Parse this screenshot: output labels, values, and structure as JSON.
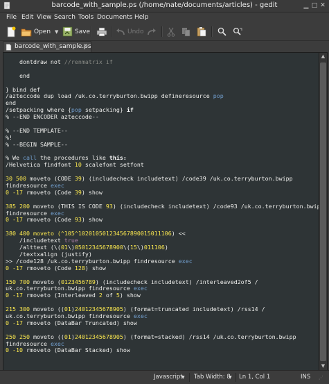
{
  "window": {
    "title": "barcode_with_sample.ps (/home/nate/documents/articles) - gedit"
  },
  "menu": {
    "items": [
      "File",
      "Edit",
      "View",
      "Search",
      "Tools",
      "Documents",
      "Help"
    ]
  },
  "toolbar": {
    "open_label": "Open",
    "save_label": "Save",
    "undo_label": "Undo"
  },
  "tab": {
    "label": "barcode_with_sample.ps"
  },
  "code": {
    "lines": [
      [
        {
          "t": "    dontdraw not "
        },
        {
          "t": "//renmatrix if",
          "c": "g"
        }
      ],
      [],
      [
        {
          "t": "    end"
        }
      ],
      [],
      [
        {
          "t": "} bind def"
        }
      ],
      [
        {
          "t": "/azteccode dup load /uk.co.terryburton.bwipp defineresource "
        },
        {
          "t": "pop",
          "c": "b"
        }
      ],
      [
        {
          "t": "end"
        }
      ],
      [
        {
          "t": "/setpacking where {"
        },
        {
          "t": "pop",
          "c": "b"
        },
        {
          "t": " setpacking} "
        },
        {
          "t": "if",
          "c": "w"
        }
      ],
      [
        {
          "t": "% --END ENCODER azteccode--"
        }
      ],
      [],
      [
        {
          "t": "% --END TEMPLATE--"
        }
      ],
      [
        {
          "t": "%!"
        }
      ],
      [
        {
          "t": "% --BEGIN SAMPLE--"
        }
      ],
      [],
      [
        {
          "t": "% We "
        },
        {
          "t": "call",
          "c": "b"
        },
        {
          "t": " the procedures like "
        },
        {
          "t": "this:",
          "c": "w"
        }
      ],
      [
        {
          "t": "/Helvetica findfont "
        },
        {
          "t": "10",
          "c": "y"
        },
        {
          "t": " scalefont setfont"
        }
      ],
      [],
      [
        {
          "t": "30 500",
          "c": "y"
        },
        {
          "t": " moveto (CODE "
        },
        {
          "t": "39",
          "c": "y"
        },
        {
          "t": ") (includecheck includetext) /code39 /uk.co.terryburton.bwipp"
        }
      ],
      [
        {
          "t": "findresource "
        },
        {
          "t": "exec",
          "c": "b"
        }
      ],
      [
        {
          "t": "0 -17",
          "c": "y"
        },
        {
          "t": " rmoveto (Code "
        },
        {
          "t": "39",
          "c": "y"
        },
        {
          "t": ") show"
        }
      ],
      [],
      [
        {
          "t": "385 200",
          "c": "y"
        },
        {
          "t": " moveto (THIS IS CODE "
        },
        {
          "t": "93",
          "c": "y"
        },
        {
          "t": ") (includecheck includetext) /code93 /uk.co.terryburton.bwipp"
        }
      ],
      [
        {
          "t": "findresource "
        },
        {
          "t": "exec",
          "c": "b"
        }
      ],
      [
        {
          "t": "0 -17",
          "c": "y"
        },
        {
          "t": " rmoveto (Code "
        },
        {
          "t": "93",
          "c": "y"
        },
        {
          "t": ") show"
        }
      ],
      [],
      [
        {
          "t": "380 400",
          "c": "y"
        },
        {
          "t": " moveto (^105^102010501234567890015011106",
          "c": "y"
        },
        {
          "t": ") <<"
        }
      ],
      [
        {
          "t": "    /includetext "
        },
        {
          "t": "true",
          "c": "p"
        }
      ],
      [
        {
          "t": "    /alttext (\\("
        },
        {
          "t": "01",
          "c": "y"
        },
        {
          "t": "\\)"
        },
        {
          "t": "05012345678900",
          "c": "y"
        },
        {
          "t": "\\("
        },
        {
          "t": "15",
          "c": "y"
        },
        {
          "t": "\\)"
        },
        {
          "t": "011106",
          "c": "y"
        },
        {
          "t": ")"
        }
      ],
      [
        {
          "t": "    /textxalign (justify)"
        }
      ],
      [
        {
          "t": ">> /code128 /uk.co.terryburton.bwipp findresource "
        },
        {
          "t": "exec",
          "c": "b"
        }
      ],
      [
        {
          "t": "0 -17",
          "c": "y"
        },
        {
          "t": " rmoveto (Code "
        },
        {
          "t": "128",
          "c": "y"
        },
        {
          "t": ") show"
        }
      ],
      [],
      [
        {
          "t": "150 700",
          "c": "y"
        },
        {
          "t": " moveto ("
        },
        {
          "t": "0123456789",
          "c": "y"
        },
        {
          "t": ") (includecheck includetext) /interleaved2of5 /"
        }
      ],
      [
        {
          "t": "uk.co.terryburton.bwipp findresource "
        },
        {
          "t": "exec",
          "c": "b"
        }
      ],
      [
        {
          "t": "0 -17",
          "c": "y"
        },
        {
          "t": " rmoveto (Interleaved "
        },
        {
          "t": "2",
          "c": "y"
        },
        {
          "t": " of "
        },
        {
          "t": "5",
          "c": "y"
        },
        {
          "t": ") show"
        }
      ],
      [],
      [
        {
          "t": "215 300",
          "c": "y"
        },
        {
          "t": " moveto (("
        },
        {
          "t": "01",
          "c": "y"
        },
        {
          "t": ")"
        },
        {
          "t": "24012345678905",
          "c": "y"
        },
        {
          "t": ") (format=truncated includetext) /rss14 /"
        }
      ],
      [
        {
          "t": "uk.co.terryburton.bwipp findresource "
        },
        {
          "t": "exec",
          "c": "b"
        }
      ],
      [
        {
          "t": "0 -17",
          "c": "y"
        },
        {
          "t": " rmoveto (DataBar Truncated) show"
        }
      ],
      [],
      [
        {
          "t": "250 250",
          "c": "y"
        },
        {
          "t": " moveto (("
        },
        {
          "t": "01",
          "c": "y"
        },
        {
          "t": ")"
        },
        {
          "t": "24012345678905",
          "c": "y"
        },
        {
          "t": ") (format=stacked) /rss14 /uk.co.terryburton.bwipp"
        }
      ],
      [
        {
          "t": "findresource "
        },
        {
          "t": "exec",
          "c": "b"
        }
      ],
      [
        {
          "t": "0 -10",
          "c": "y"
        },
        {
          "t": " rmoveto (DataBar Stacked) show"
        }
      ]
    ]
  },
  "status": {
    "language": "Javascript",
    "tab_width": "Tab Width: 8",
    "position": "Ln 1, Col 1",
    "mode": "INS"
  }
}
